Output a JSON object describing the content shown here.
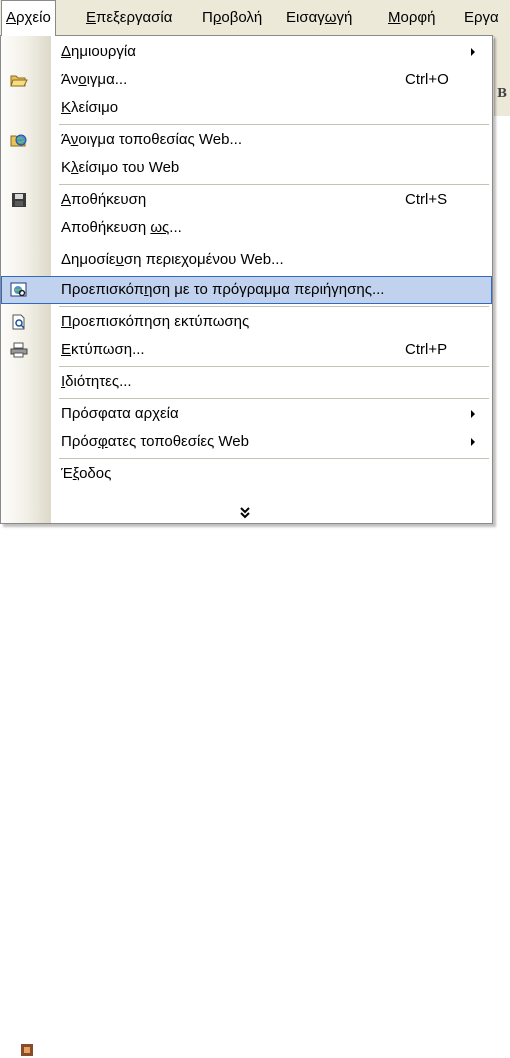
{
  "menubar": {
    "items": [
      {
        "pre": "",
        "mn": "Α",
        "post": "ρχείο",
        "active": true
      },
      {
        "pre": "",
        "mn": "Ε",
        "post": "πεξεργασία",
        "active": false
      },
      {
        "pre": "Π",
        "mn": "ρ",
        "post": "οβολή",
        "active": false
      },
      {
        "pre": "Εισαγ",
        "mn": "ω",
        "post": "γή",
        "active": false
      },
      {
        "pre": "",
        "mn": "Μ",
        "post": "ορφή",
        "active": false
      },
      {
        "pre": "Εργα",
        "mn": "",
        "post": "",
        "active": false
      }
    ]
  },
  "file_menu": {
    "items": [
      {
        "pre": "",
        "mn": "Δ",
        "post": "ημιουργία",
        "shortcut": "",
        "submenu": true,
        "icon": "",
        "highlighted": false
      },
      {
        "pre": "Άν",
        "mn": "ο",
        "post": "ιγμα...",
        "shortcut": "Ctrl+O",
        "submenu": false,
        "icon": "open-folder-icon",
        "highlighted": false
      },
      {
        "pre": "",
        "mn": "Κ",
        "post": "λείσιμο",
        "shortcut": "",
        "submenu": false,
        "icon": "",
        "highlighted": false
      },
      {
        "pre": "Ά",
        "mn": "ν",
        "post": "οιγμα τοποθεσίας Web...",
        "shortcut": "",
        "submenu": false,
        "icon": "web-folder-icon",
        "highlighted": false
      },
      {
        "pre": "Κ",
        "mn": "λ",
        "post": "είσιμο του Web",
        "shortcut": "",
        "submenu": false,
        "icon": "",
        "highlighted": false
      },
      {
        "pre": "",
        "mn": "Α",
        "post": "ποθήκευση",
        "shortcut": "Ctrl+S",
        "submenu": false,
        "icon": "floppy-disk-icon",
        "highlighted": false
      },
      {
        "pre": "Αποθήκευση ",
        "mn": "ως",
        "post": "...",
        "shortcut": "",
        "submenu": false,
        "icon": "",
        "highlighted": false
      },
      {
        "pre": "Δημοσίε",
        "mn": "υ",
        "post": "ση περιεχομένου Web...",
        "shortcut": "",
        "submenu": false,
        "icon": "",
        "highlighted": false
      },
      {
        "pre": "Προεπισκόπ",
        "mn": "η",
        "post": "ση με το πρόγραμμα περιήγησης...",
        "shortcut": "",
        "submenu": false,
        "icon": "web-preview-icon",
        "highlighted": true
      },
      {
        "pre": "",
        "mn": "Π",
        "post": "ροεπισκόπηση εκτύπωσης",
        "shortcut": "",
        "submenu": false,
        "icon": "print-preview-icon",
        "highlighted": false
      },
      {
        "pre": "",
        "mn": "Ε",
        "post": "κτύπωση...",
        "shortcut": "Ctrl+P",
        "submenu": false,
        "icon": "printer-icon",
        "highlighted": false
      },
      {
        "pre": "",
        "mn": "Ι",
        "post": "διότητες...",
        "shortcut": "",
        "submenu": false,
        "icon": "",
        "highlighted": false
      },
      {
        "pre": "Πρόσφατα αρ",
        "mn": "χ",
        "post": "εία",
        "shortcut": "",
        "submenu": true,
        "icon": "",
        "highlighted": false
      },
      {
        "pre": "Πρόσ",
        "mn": "φ",
        "post": "ατες τοποθεσίες Web",
        "shortcut": "",
        "submenu": true,
        "icon": "",
        "highlighted": false
      },
      {
        "pre": "Έ",
        "mn": "ξ",
        "post": "οδος",
        "shortcut": "",
        "submenu": false,
        "icon": "",
        "highlighted": false
      }
    ],
    "expand_icon": "double-chevron-down-icon"
  },
  "background": {
    "toolbar_letter": "B"
  }
}
